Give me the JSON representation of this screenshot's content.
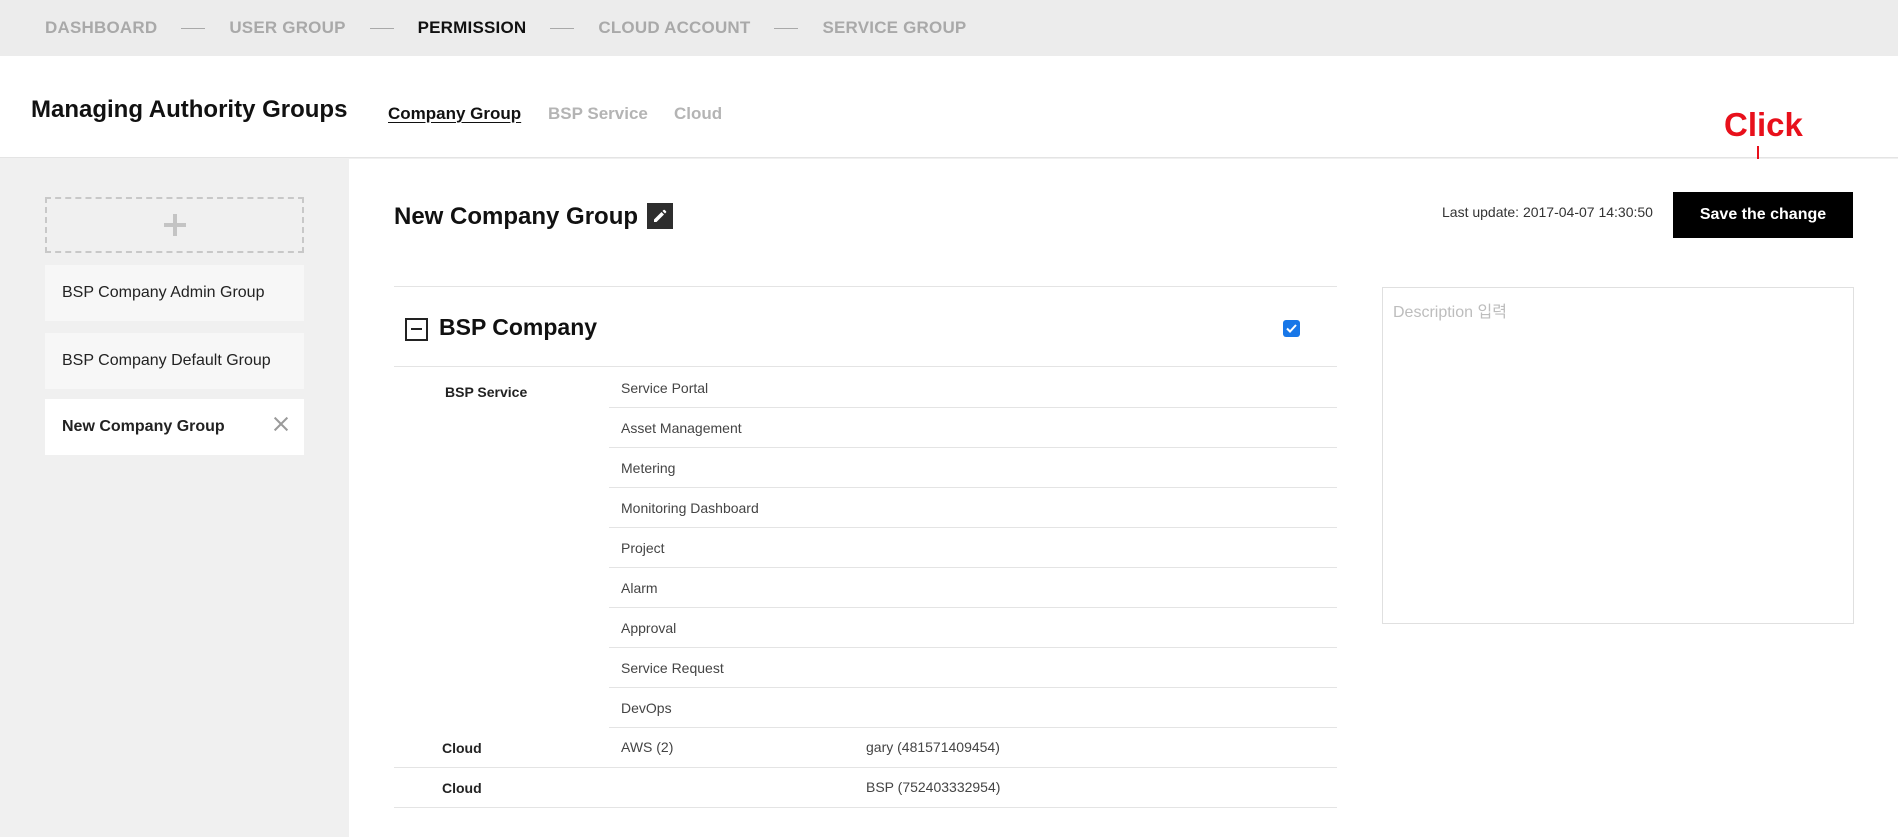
{
  "top_nav": {
    "items": [
      {
        "label": "DASHBOARD",
        "active": false
      },
      {
        "label": "USER GROUP",
        "active": false
      },
      {
        "label": "PERMISSION",
        "active": true
      },
      {
        "label": "CLOUD ACCOUNT",
        "active": false
      },
      {
        "label": "SERVICE GROUP",
        "active": false
      }
    ]
  },
  "header": {
    "title": "Managing Authority Groups",
    "tabs": [
      {
        "label": "Company Group",
        "active": true
      },
      {
        "label": "BSP Service",
        "active": false
      },
      {
        "label": "Cloud",
        "active": false
      }
    ]
  },
  "annotation": {
    "label": "Click",
    "color": "#e8101b"
  },
  "sidebar": {
    "add_icon": "plus-icon",
    "groups": [
      {
        "label": "BSP Company Admin Group",
        "active": false
      },
      {
        "label": "BSP Company Default Group",
        "active": false
      },
      {
        "label": "New Company Group",
        "active": true
      }
    ]
  },
  "main": {
    "group_title": "New Company Group",
    "edit_icon": "pencil-icon",
    "last_update": "Last update: 2017-04-07 14:30:50",
    "save_label": "Save the change",
    "section_title": "BSP Company",
    "section_checked": true,
    "service_label": "BSP Service",
    "services": [
      "Service Portal",
      "Asset Management",
      "Metering",
      "Monitoring Dashboard",
      "Project",
      "Alarm",
      "Approval",
      "Service Request",
      "DevOps"
    ],
    "cloud_rows": [
      {
        "label": "Cloud",
        "provider": "AWS (2)",
        "account": "gary (481571409454)"
      },
      {
        "label": "Cloud",
        "provider": "",
        "account": "BSP (752403332954)"
      }
    ],
    "description_placeholder": "Description 입력"
  },
  "colors": {
    "accent": "#000000",
    "checkbox": "#1877e8",
    "annotation": "#e8101b"
  }
}
